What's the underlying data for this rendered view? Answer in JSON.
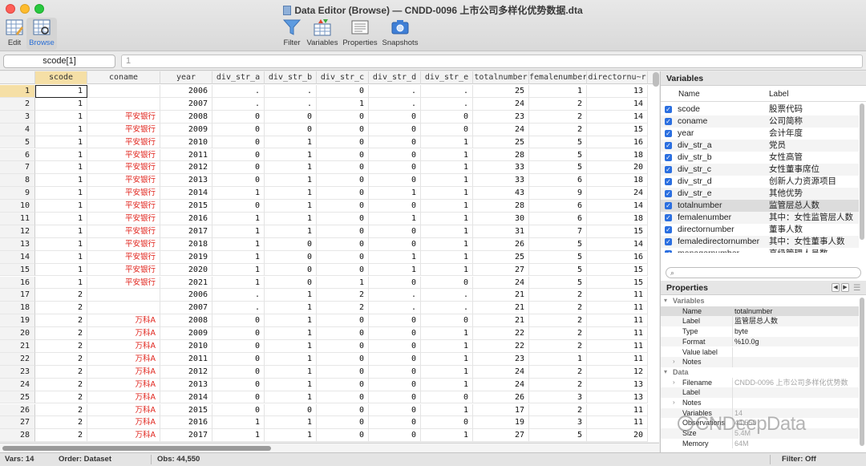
{
  "window": {
    "title": "Data Editor (Browse) — CNDD-0096 上市公司多样化优势数据.dta"
  },
  "toolbar": {
    "edit": "Edit",
    "browse": "Browse",
    "filter": "Filter",
    "variables": "Variables",
    "properties": "Properties",
    "snapshots": "Snapshots"
  },
  "refbar": {
    "cell_ref": "scode[1]",
    "cell_value": "1"
  },
  "grid": {
    "columns": [
      "scode",
      "coname",
      "year",
      "div_str_a",
      "div_str_b",
      "div_str_c",
      "div_str_d",
      "div_str_e",
      "totalnumber",
      "femalenumber",
      "directornu~r"
    ],
    "rows": [
      [
        "1",
        "1",
        "",
        "2006",
        ".",
        ".",
        "0",
        ".",
        ".",
        "25",
        "1",
        "13"
      ],
      [
        "2",
        "1",
        "",
        "2007",
        ".",
        ".",
        "1",
        ".",
        ".",
        "24",
        "2",
        "14"
      ],
      [
        "3",
        "1",
        "平安银行",
        "2008",
        "0",
        "0",
        "0",
        "0",
        "0",
        "23",
        "2",
        "14"
      ],
      [
        "4",
        "1",
        "平安银行",
        "2009",
        "0",
        "0",
        "0",
        "0",
        "0",
        "24",
        "2",
        "15"
      ],
      [
        "5",
        "1",
        "平安银行",
        "2010",
        "0",
        "1",
        "0",
        "0",
        "1",
        "25",
        "5",
        "16"
      ],
      [
        "6",
        "1",
        "平安银行",
        "2011",
        "0",
        "1",
        "0",
        "0",
        "1",
        "28",
        "5",
        "18"
      ],
      [
        "7",
        "1",
        "平安银行",
        "2012",
        "0",
        "1",
        "0",
        "0",
        "1",
        "33",
        "5",
        "20"
      ],
      [
        "8",
        "1",
        "平安银行",
        "2013",
        "0",
        "1",
        "0",
        "0",
        "1",
        "33",
        "6",
        "18"
      ],
      [
        "9",
        "1",
        "平安银行",
        "2014",
        "1",
        "1",
        "0",
        "1",
        "1",
        "43",
        "9",
        "24"
      ],
      [
        "10",
        "1",
        "平安银行",
        "2015",
        "0",
        "1",
        "0",
        "0",
        "1",
        "28",
        "6",
        "14"
      ],
      [
        "11",
        "1",
        "平安银行",
        "2016",
        "1",
        "1",
        "0",
        "1",
        "1",
        "30",
        "6",
        "18"
      ],
      [
        "12",
        "1",
        "平安银行",
        "2017",
        "1",
        "1",
        "0",
        "0",
        "1",
        "31",
        "7",
        "15"
      ],
      [
        "13",
        "1",
        "平安银行",
        "2018",
        "1",
        "0",
        "0",
        "0",
        "1",
        "26",
        "5",
        "14"
      ],
      [
        "14",
        "1",
        "平安银行",
        "2019",
        "1",
        "0",
        "0",
        "1",
        "1",
        "25",
        "5",
        "16"
      ],
      [
        "15",
        "1",
        "平安银行",
        "2020",
        "1",
        "0",
        "0",
        "1",
        "1",
        "27",
        "5",
        "15"
      ],
      [
        "16",
        "1",
        "平安银行",
        "2021",
        "1",
        "0",
        "1",
        "0",
        "0",
        "24",
        "5",
        "15"
      ],
      [
        "17",
        "2",
        "",
        "2006",
        ".",
        "1",
        "2",
        ".",
        ".",
        "21",
        "2",
        "11"
      ],
      [
        "18",
        "2",
        "",
        "2007",
        ".",
        "1",
        "2",
        ".",
        ".",
        "21",
        "2",
        "11"
      ],
      [
        "19",
        "2",
        "万科A",
        "2008",
        "0",
        "1",
        "0",
        "0",
        "0",
        "21",
        "2",
        "11"
      ],
      [
        "20",
        "2",
        "万科A",
        "2009",
        "0",
        "1",
        "0",
        "0",
        "1",
        "22",
        "2",
        "11"
      ],
      [
        "21",
        "2",
        "万科A",
        "2010",
        "0",
        "1",
        "0",
        "0",
        "1",
        "22",
        "2",
        "11"
      ],
      [
        "22",
        "2",
        "万科A",
        "2011",
        "0",
        "1",
        "0",
        "0",
        "1",
        "23",
        "1",
        "11"
      ],
      [
        "23",
        "2",
        "万科A",
        "2012",
        "0",
        "1",
        "0",
        "0",
        "1",
        "24",
        "2",
        "12"
      ],
      [
        "24",
        "2",
        "万科A",
        "2013",
        "0",
        "1",
        "0",
        "0",
        "1",
        "24",
        "2",
        "13"
      ],
      [
        "25",
        "2",
        "万科A",
        "2014",
        "0",
        "1",
        "0",
        "0",
        "0",
        "26",
        "3",
        "13"
      ],
      [
        "26",
        "2",
        "万科A",
        "2015",
        "0",
        "0",
        "0",
        "0",
        "1",
        "17",
        "2",
        "11"
      ],
      [
        "27",
        "2",
        "万科A",
        "2016",
        "1",
        "1",
        "0",
        "0",
        "0",
        "19",
        "3",
        "11"
      ],
      [
        "28",
        "2",
        "万科A",
        "2017",
        "1",
        "1",
        "0",
        "0",
        "1",
        "27",
        "5",
        "20"
      ]
    ]
  },
  "variables_panel": {
    "title": "Variables",
    "col_name": "Name",
    "col_label": "Label",
    "items": [
      {
        "name": "scode",
        "label": "股票代码"
      },
      {
        "name": "coname",
        "label": "公司简称"
      },
      {
        "name": "year",
        "label": "会计年度"
      },
      {
        "name": "div_str_a",
        "label": "党员"
      },
      {
        "name": "div_str_b",
        "label": "女性高管"
      },
      {
        "name": "div_str_c",
        "label": "女性董事席位"
      },
      {
        "name": "div_str_d",
        "label": "创新人力资源项目"
      },
      {
        "name": "div_str_e",
        "label": "其他优势"
      },
      {
        "name": "totalnumber",
        "label": "监管层总人数"
      },
      {
        "name": "femalenumber",
        "label": "其中：女性监管层人数"
      },
      {
        "name": "directornumber",
        "label": "董事人数"
      },
      {
        "name": "femaledirectornumber",
        "label": "其中：女性董事人数"
      },
      {
        "name": "managernumber",
        "label": "高级管理人员数"
      }
    ]
  },
  "properties_panel": {
    "title": "Properties",
    "variables_section": "Variables",
    "var_rows": [
      {
        "k": "Name",
        "v": "totalnumber"
      },
      {
        "k": "Label",
        "v": "监管层总人数"
      },
      {
        "k": "Type",
        "v": "byte"
      },
      {
        "k": "Format",
        "v": "%10.0g"
      },
      {
        "k": "Value label",
        "v": ""
      },
      {
        "k": "Notes",
        "v": ""
      }
    ],
    "data_section": "Data",
    "data_rows": [
      {
        "k": "Filename",
        "v": "CNDD-0096 上市公司多样化优势数"
      },
      {
        "k": "Label",
        "v": ""
      },
      {
        "k": "Notes",
        "v": ""
      },
      {
        "k": "Variables",
        "v": "14"
      },
      {
        "k": "Observations",
        "v": "44,550"
      },
      {
        "k": "Size",
        "v": "5.4M"
      },
      {
        "k": "Memory",
        "v": "64M"
      }
    ]
  },
  "status": {
    "vars": "Vars: 14",
    "order": "Order: Dataset",
    "obs": "Obs: 44,550",
    "filter": "Filter: Off"
  },
  "watermark": "CNDeepData",
  "colors": {
    "string_text": "#e0231b",
    "selected_header": "#f5dfa6",
    "checkbox": "#2b6fe0"
  }
}
